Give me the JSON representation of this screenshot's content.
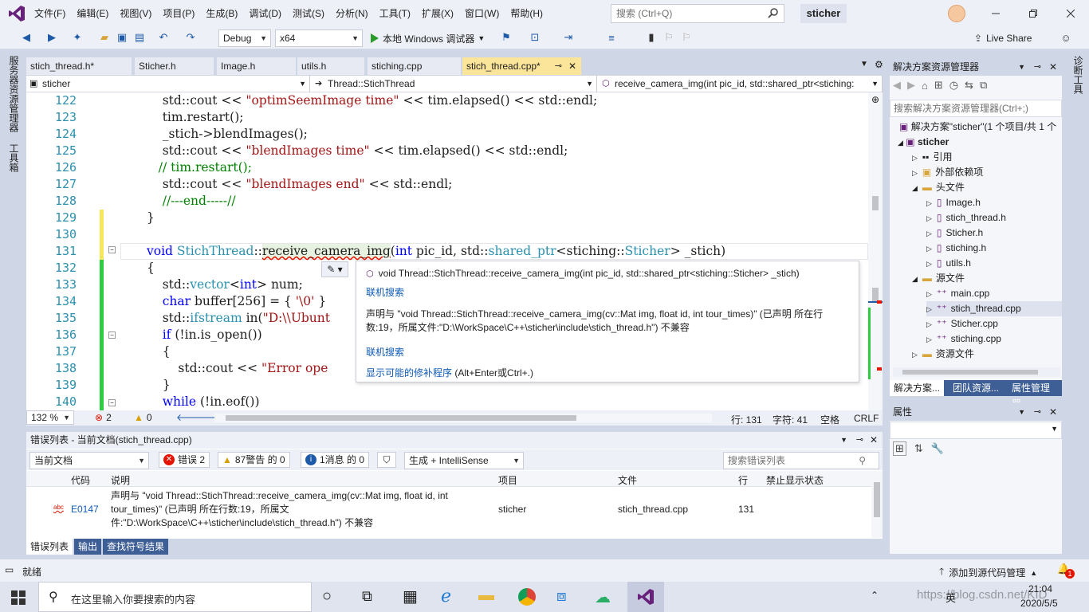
{
  "menu": [
    "文件(F)",
    "编辑(E)",
    "视图(V)",
    "项目(P)",
    "生成(B)",
    "调试(D)",
    "测试(S)",
    "分析(N)",
    "工具(T)",
    "扩展(X)",
    "窗口(W)",
    "帮助(H)"
  ],
  "search": {
    "placeholder": "搜索 (Ctrl+Q)"
  },
  "solution_name": "sticher",
  "toolbar": {
    "config": "Debug",
    "platform": "x64",
    "run_label": "本地 Windows 调试器",
    "live_share": "Live Share"
  },
  "left_strip": {
    "server_explorer": "服务器资源管理器",
    "toolbox": "工具箱"
  },
  "right_strip": {
    "diag": "诊断工具"
  },
  "tabs": [
    "stich_thread.h*",
    "Sticher.h",
    "Image.h",
    "utils.h",
    "stiching.cpp",
    "stich_thread.cpp*"
  ],
  "nav": {
    "project": "sticher",
    "scope": "Thread::StichThread",
    "member": "receive_camera_img(int pic_id, std::shared_ptr<stiching:"
  },
  "code_lines": [
    {
      "n": "122",
      "text": "    std::cout << \"optimSeemImage time\" << tim.elapsed() << std::endl;"
    },
    {
      "n": "123",
      "text": "    tim.restart();"
    },
    {
      "n": "124",
      "text": "    _stich->blendImages();"
    },
    {
      "n": "125",
      "text": "    std::cout << \"blendImages time\" << tim.elapsed() << std::endl;"
    },
    {
      "n": "126",
      "text": "   // tim.restart();"
    },
    {
      "n": "127",
      "text": "    std::cout << \"blendImages end\" << std::endl;"
    },
    {
      "n": "128",
      "text": "    //---end-----//"
    },
    {
      "n": "129",
      "text": "}"
    },
    {
      "n": "130",
      "text": ""
    },
    {
      "n": "131",
      "text": "void StichThread::receive_camera_img(int pic_id, std::shared_ptr<stiching::Sticher> _stich)"
    },
    {
      "n": "132",
      "text": "{"
    },
    {
      "n": "133",
      "text": "    std::vector<int> num;"
    },
    {
      "n": "134",
      "text": "    char buffer[256] = { '\\0' }"
    },
    {
      "n": "135",
      "text": "    std::ifstream in(\"D:\\\\Ubunt"
    },
    {
      "n": "136",
      "text": "    if (!in.is_open())"
    },
    {
      "n": "137",
      "text": "    {"
    },
    {
      "n": "138",
      "text": "        std::cout << \"Error ope"
    },
    {
      "n": "139",
      "text": "    }"
    },
    {
      "n": "140",
      "text": "    while (!in.eof())"
    }
  ],
  "tooltip": {
    "signature": "void Thread::StichThread::receive_camera_img(int pic_id, std::shared_ptr<stiching::Sticher> _stich)",
    "search1": "联机搜索",
    "message": "声明与 \"void Thread::StichThread::receive_camera_img(cv::Mat img, float id, int tour_times)\" (已声明 所在行数:19，所属文件:\"D:\\WorkSpace\\C++\\sticher\\include\\stich_thread.h\") 不兼容",
    "search2": "联机搜索",
    "fix_link": "显示可能的修补程序",
    "fix_shortcut": "(Alt+Enter或Ctrl+.)"
  },
  "editor_status": {
    "zoom": "132 %",
    "errors": "2",
    "warnings": "0",
    "line": "行: 131",
    "char": "字符: 41",
    "space": "空格",
    "eol": "CRLF"
  },
  "error_list": {
    "title": "错误列表 - 当前文档(stich_thread.cpp)",
    "scope": "当前文档",
    "errors": "错误 2",
    "warnings": "87警告 的 0",
    "messages": "1消息 的 0",
    "build": "生成 + IntelliSense",
    "search_placeholder": "搜索错误列表",
    "columns": [
      "代码",
      "说明",
      "项目",
      "文件",
      "行",
      "禁止显示状态"
    ],
    "rows": [
      {
        "code": "E0147",
        "desc": "声明与 \"void Thread::StichThread::receive_camera_img(cv::Mat img, float id, int tour_times)\" (已声明 所在行数:19，所属文件:\"D:\\WorkSpace\\C++\\sticher\\include\\stich_thread.h\") 不兼容",
        "project": "sticher",
        "file": "stich_thread.cpp",
        "line": "131"
      }
    ]
  },
  "bottom_tabs": [
    "错误列表",
    "输出",
    "查找符号结果"
  ],
  "solution_explorer": {
    "title": "解决方案资源管理器",
    "search_placeholder": "搜索解决方案资源管理器(Ctrl+;)",
    "solution": "解决方案\"sticher\"(1 个项目/共 1 个",
    "project": "sticher",
    "items": [
      {
        "label": "引用",
        "level": 2
      },
      {
        "label": "外部依赖项",
        "level": 2
      },
      {
        "label": "头文件",
        "level": 2
      },
      {
        "label": "Image.h",
        "level": 3
      },
      {
        "label": "stich_thread.h",
        "level": 3
      },
      {
        "label": "Sticher.h",
        "level": 3
      },
      {
        "label": "stiching.h",
        "level": 3
      },
      {
        "label": "utils.h",
        "level": 3
      },
      {
        "label": "源文件",
        "level": 2
      },
      {
        "label": "main.cpp",
        "level": 3
      },
      {
        "label": "stich_thread.cpp",
        "level": 3
      },
      {
        "label": "Sticher.cpp",
        "level": 3
      },
      {
        "label": "stiching.cpp",
        "level": 3
      },
      {
        "label": "资源文件",
        "level": 2
      }
    ],
    "tabs": [
      "解决方案...",
      "团队资源...",
      "属性管理器"
    ]
  },
  "properties": {
    "title": "属性"
  },
  "statusbar": {
    "ready": "就绪",
    "source_control": "添加到源代码管理",
    "notif": "1"
  },
  "taskbar": {
    "search_placeholder": "在这里输入你要搜索的内容",
    "time": "21:04",
    "date": "2020/5/5",
    "ime": "英",
    "watermark": "https://blog.csdn.net/KID"
  },
  "colors": {
    "accent": "#68217a",
    "tab_active": "#fbe59a",
    "link": "#0e5ab5",
    "error": "#e51400"
  }
}
